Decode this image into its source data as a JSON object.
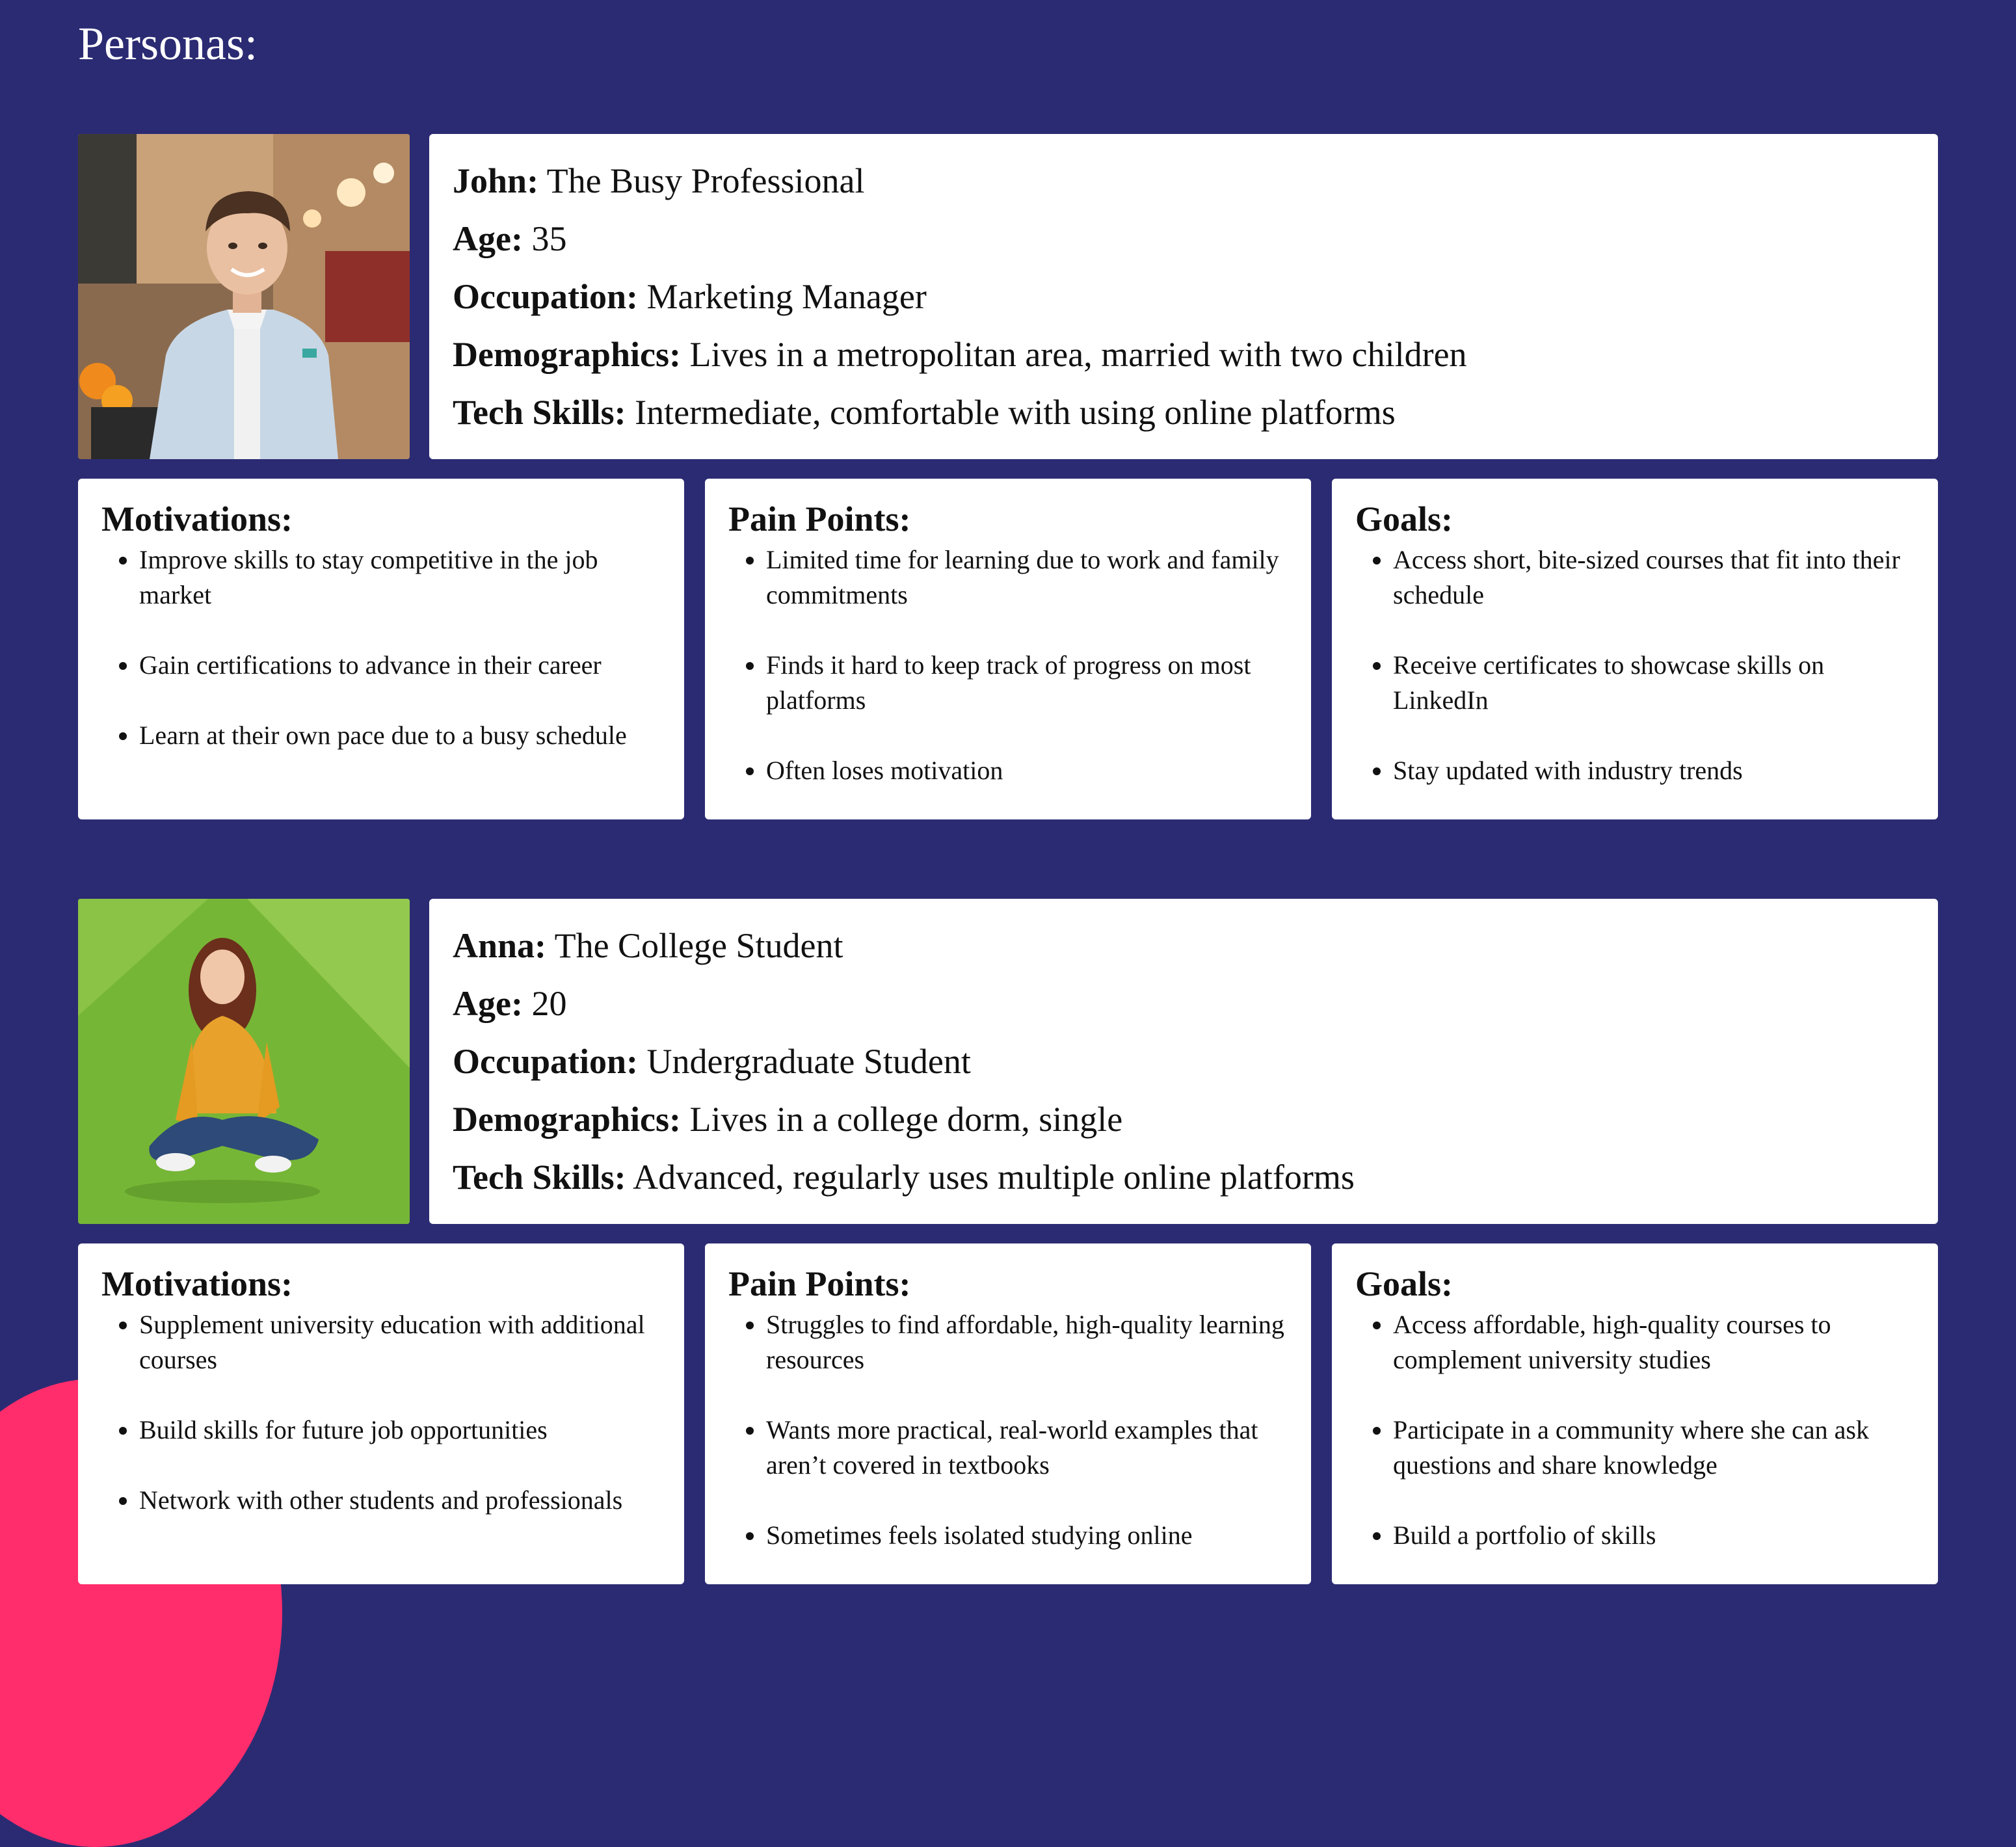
{
  "page_title": "Personas:",
  "personas": [
    {
      "photo_icon": "man-portrait-photo",
      "name": "John:",
      "tagline": "The Busy Professional",
      "fields": [
        {
          "label": "Age:",
          "value": "35"
        },
        {
          "label": "Occupation:",
          "value": "Marketing Manager"
        },
        {
          "label": "Demographics:",
          "value": "Lives in a metropolitan area, married with two children"
        },
        {
          "label": "Tech Skills:",
          "value": "Intermediate, comfortable with using online platforms"
        }
      ],
      "motivations": {
        "title": "Motivations:",
        "items": [
          "Improve skills to stay competitive in the job market",
          "Gain certifications to advance in their career",
          "Learn at their own pace due to a busy schedule"
        ]
      },
      "pain_points": {
        "title": "Pain Points:",
        "items": [
          "Limited time for learning due to work and family commitments",
          "Finds it hard to keep track of progress on most platforms",
          "Often loses motivation"
        ]
      },
      "goals": {
        "title": "Goals:",
        "items": [
          "Access short, bite-sized courses that fit into their schedule",
          "Receive certificates to showcase skills on LinkedIn",
          "Stay updated with industry trends"
        ]
      }
    },
    {
      "photo_icon": "woman-sitting-on-grass-photo",
      "name": "Anna:",
      "tagline": "The College Student",
      "fields": [
        {
          "label": "Age:",
          "value": "20"
        },
        {
          "label": "Occupation:",
          "value": "Undergraduate Student"
        },
        {
          "label": "Demographics:",
          "value": "Lives in a college dorm, single"
        },
        {
          "label": "Tech Skills:",
          "value": "Advanced, regularly uses multiple online platforms"
        }
      ],
      "motivations": {
        "title": "Motivations:",
        "items": [
          "Supplement university education with additional courses",
          "Build skills for future job opportunities",
          "Network with other students and professionals"
        ]
      },
      "pain_points": {
        "title": "Pain Points:",
        "items": [
          "Struggles to find affordable, high-quality learning resources",
          "Wants more practical, real-world examples that aren’t covered in textbooks",
          "Sometimes feels isolated studying online"
        ]
      },
      "goals": {
        "title": "Goals:",
        "items": [
          "Access affordable, high-quality courses to complement university studies",
          "Participate in a community where she can ask questions and share knowledge",
          "Build a portfolio of skills"
        ]
      }
    }
  ],
  "colors": {
    "background": "#2b2b73",
    "accent_blob": "#ff2d6b",
    "card": "#ffffff"
  }
}
